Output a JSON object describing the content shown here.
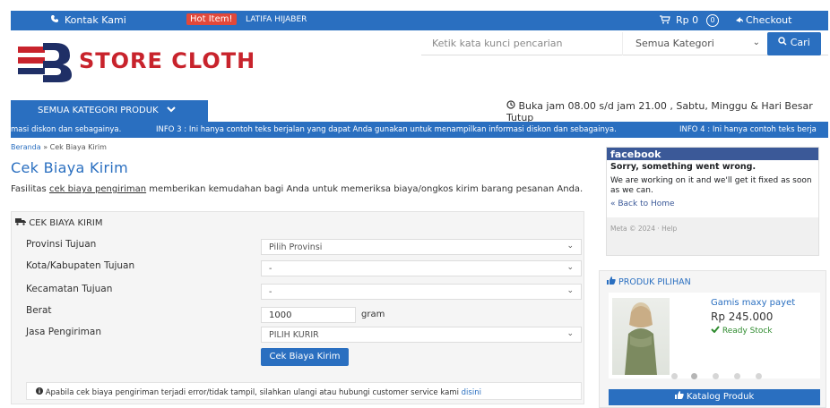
{
  "topbar": {
    "contact_icon": "phone-icon",
    "contact_label": "Kontak Kami",
    "hot_label": "Hot Item!",
    "hot_text": "LATIFA HIJABER",
    "cart_icon": "cart-icon",
    "cart_total": "Rp 0",
    "cart_count": "0",
    "checkout_icon": "arrow-icon",
    "checkout_label": "Checkout"
  },
  "logo": {
    "text": "STORE CLOTH",
    "mark": "R"
  },
  "search": {
    "placeholder": "Ketik kata kunci pencarian",
    "category": "Semua Kategori",
    "button_label": "Cari"
  },
  "nav": {
    "category_button": "SEMUA KATEGORI PRODUK",
    "hours": "Buka jam 08.00 s/d jam 21.00 , Sabtu, Minggu & Hari Besar Tutup"
  },
  "marquee": {
    "item1": "masi diskon dan sebagainya.",
    "item2": "INFO 3 : Ini hanya contoh teks berjalan yang dapat Anda gunakan untuk menampilkan informasi diskon dan sebagainya.",
    "item3": "INFO 4 : Ini hanya contoh teks berja"
  },
  "breadcrumb": {
    "home": "Beranda",
    "separator": "»",
    "current": "Cek Biaya Kirim"
  },
  "page": {
    "title": "Cek Biaya Kirim",
    "desc_prefix": "Fasilitas ",
    "desc_link": "cek biaya pengiriman",
    "desc_suffix": " memberikan kemudahan bagi Anda untuk memeriksa biaya/ongkos kirim barang pesanan Anda."
  },
  "form": {
    "header": "CEK BIAYA KIRIM",
    "labels": {
      "provinsi": "Provinsi Tujuan",
      "kota": "Kota/Kabupaten Tujuan",
      "kecamatan": "Kecamatan Tujuan",
      "berat": "Berat",
      "jasa": "Jasa Pengiriman"
    },
    "values": {
      "provinsi": "Pilih Provinsi",
      "kota": "-",
      "kecamatan": "-",
      "berat": "1000",
      "berat_unit": "gram",
      "jasa": "PILIH KURIR"
    },
    "submit": "Cek Biaya Kirim",
    "note": "Apabila cek biaya pengiriman terjadi error/tidak tampil, silahkan ulangi atau hubungi customer service kami",
    "note_link": "disini"
  },
  "facebook": {
    "brand": "facebook",
    "error_title": "Sorry, something went wrong.",
    "error_msg": "We are working on it and we'll get it fixed as soon as we can.",
    "back": "« Back to Home",
    "meta": "Meta © 2024 · Help"
  },
  "produk": {
    "header": "PRODUK PILIHAN",
    "name": "Gamis maxy payet",
    "price": "Rp 245.000",
    "stock": "Ready Stock",
    "catalog": "Katalog Produk"
  },
  "colors": {
    "primary": "#2a6fc0",
    "brand_red": "#c8232c",
    "hot": "#e2483a",
    "facebook": "#3b5998"
  }
}
